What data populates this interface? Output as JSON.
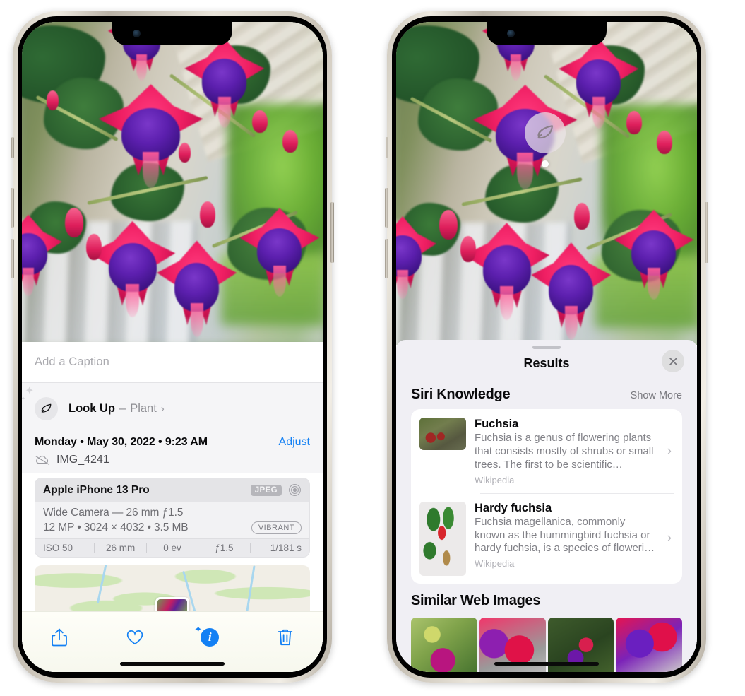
{
  "left_phone": {
    "photo": {
      "alt": "fuchsia-flowers-photo"
    },
    "caption": {
      "placeholder": "Add a Caption",
      "value": ""
    },
    "lookup": {
      "icon": "leaf-icon",
      "label": "Look Up",
      "dash": "–",
      "subject": "Plant",
      "chevron": "›"
    },
    "metadata": {
      "date": "Monday • May 30, 2022 • 9:23 AM",
      "adjust_label": "Adjust",
      "cloud_icon": "cloud-slash-icon",
      "filename": "IMG_4241"
    },
    "camera_card": {
      "model": "Apple iPhone 13 Pro",
      "format_badge": "JPEG",
      "aperture_icon": "aperture-icon",
      "lens": "Wide Camera — 26 mm ƒ1.5",
      "specs": "12 MP • 3024 × 4032 • 3.5 MB",
      "style_badge": "VIBRANT",
      "exif": [
        "ISO 50",
        "26 mm",
        "0 ev",
        "ƒ1.5",
        "1/181 s"
      ]
    },
    "map": {
      "pin": "photo-location-pin"
    },
    "toolbar": [
      {
        "name": "share-button",
        "icon": "share-icon"
      },
      {
        "name": "favorite-button",
        "icon": "heart-icon"
      },
      {
        "name": "info-button",
        "icon": "info-sparkle-icon",
        "glyph": "i"
      },
      {
        "name": "delete-button",
        "icon": "trash-icon"
      }
    ]
  },
  "right_phone": {
    "photo": {
      "alt": "fuchsia-flowers-photo"
    },
    "visual_lookup_badge": {
      "icon": "leaf-icon"
    },
    "sheet": {
      "title": "Results",
      "close_label": "×",
      "sections": [
        {
          "title": "Siri Knowledge",
          "action": "Show More",
          "items": [
            {
              "title": "Fuchsia",
              "description": "Fuchsia is a genus of flowering plants that consists mostly of shrubs or small trees. The first to be scientific…",
              "source": "Wikipedia",
              "chevron": "›"
            },
            {
              "title": "Hardy fuchsia",
              "description": "Fuchsia magellanica, commonly known as the hummingbird fuchsia or hardy fuchsia, is a species of floweri…",
              "source": "Wikipedia",
              "chevron": "›"
            }
          ]
        },
        {
          "title": "Similar Web Images",
          "images": [
            "web-image-1",
            "web-image-2",
            "web-image-3",
            "web-image-4"
          ]
        }
      ]
    }
  },
  "colors": {
    "accent_blue": "#1380f4",
    "sheet_bg": "#f0eff4",
    "card_bg": "#ffffff",
    "muted_text": "#8e8e93"
  }
}
